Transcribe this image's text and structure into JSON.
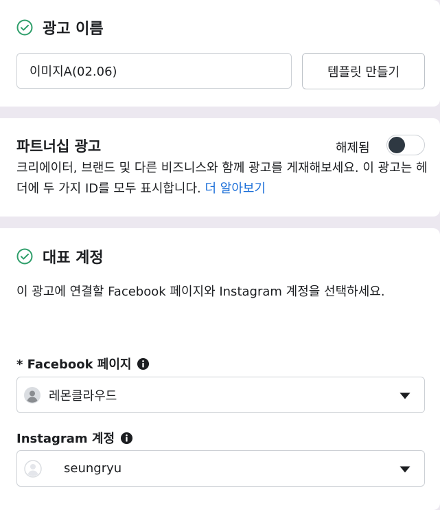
{
  "ad_name": {
    "title": "광고 이름",
    "input_value": "이미지A(02.06)",
    "template_button": "템플릿 만들기"
  },
  "partnership": {
    "title": "파트너십 광고",
    "toggle_label": "해제됨",
    "toggle_on": false,
    "description": "크리에이터, 브랜드 및 다른 비즈니스와 함께 광고를 게재해보세요. 이 광고는 헤더에 두 가지 ID를 모두 표시합니다. ",
    "learn_more": "더 알아보기"
  },
  "identity": {
    "title": "대표 계정",
    "description": "이 광고에 연결할 Facebook 페이지와 Instagram 계정을 선택하세요.",
    "facebook_label": "* Facebook 페이지",
    "facebook_value": "레몬클라우드",
    "instagram_label": "Instagram 계정",
    "instagram_value": "seungryu"
  },
  "colors": {
    "check_green": "#2e9e6a",
    "link_blue": "#1a6ed8",
    "toggle_knob": "#2e3842",
    "background": "#ece8f0"
  },
  "icons": {
    "section_check": "check-circle-icon",
    "info": "info-icon",
    "dropdown": "caret-down-icon",
    "page_avatar": "person-avatar-icon",
    "instagram_avatar": "person-avatar-outline-icon"
  }
}
